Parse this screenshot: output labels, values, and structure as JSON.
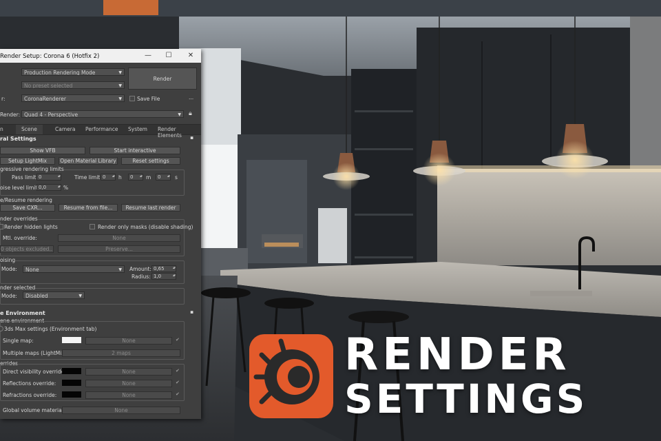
{
  "window": {
    "title": "Render Setup: Corona 6 (Hotfix 2)",
    "minimize": "—",
    "maximize": "☐",
    "close": "✕"
  },
  "setup": {
    "mode_value": "Production Rendering Mode",
    "preset_value": "No preset selected",
    "renderer_label": "r:",
    "renderer_value": "CoronaRenderer",
    "view_label": "Render:",
    "view_value": "Quad 4 - Perspective",
    "render_button": "Render",
    "save_file_label": "Save File",
    "more_label": "..."
  },
  "tabs": [
    {
      "label": "n"
    },
    {
      "label": "Scene"
    },
    {
      "label": "Camera"
    },
    {
      "label": "Performance"
    },
    {
      "label": "System"
    },
    {
      "label": "Render Elements"
    }
  ],
  "general": {
    "header": "ral Settings",
    "show_vfb": "Show VFB",
    "start_interactive": "Start interactive",
    "setup_lightmix": "Setup LightMix",
    "open_material_library": "Open Material Library",
    "reset_settings": "Reset settings"
  },
  "progressive": {
    "header": "gressive rendering limits",
    "pass_limit_label": "Pass limit:",
    "pass_limit_value": "0",
    "time_limit_label": "Time limit:",
    "time_h": "0",
    "time_m": "0",
    "time_s": "0",
    "h": "h",
    "m": "m",
    "s": "s",
    "noise_label": "oise level limit:",
    "noise_value": "0,0",
    "pct": "%"
  },
  "save_resume": {
    "header": "e/Resume rendering",
    "save_cxr": "Save CXR...",
    "resume_from_file": "Resume from file...",
    "resume_last": "Resume last render"
  },
  "overrides": {
    "header": "nder overrides",
    "render_hidden_lights": "Render hidden lights",
    "render_only_masks": "Render only masks (disable shading)",
    "mtl_override_label": "Mtl. override:",
    "mtl_override_value": "None",
    "objects_excluded": "0 objects excluded...",
    "preserve": "Preserve..."
  },
  "denoising": {
    "header": "oising",
    "mode_label": "Mode:",
    "mode_value": "None",
    "amount_label": "Amount:",
    "amount_value": "0,65",
    "radius_label": "Radius:",
    "radius_value": "1,0"
  },
  "render_selected": {
    "header": "nder selected",
    "mode_label": "Mode:",
    "mode_value": "Disabled"
  },
  "environment": {
    "section": "e Environment",
    "sub_header": "ene environment",
    "max_settings": "3ds Max settings (Environment tab)",
    "single_map_label": "Single map:",
    "single_map_value": "None",
    "multiple_maps_label": "Multiple maps (LightMix):",
    "multiple_maps_value": "2 maps",
    "overrides_header": "errides",
    "direct_label": "Direct visibility override:",
    "direct_value": "None",
    "reflections_label": "Reflections override:",
    "reflections_value": "None",
    "refractions_label": "Refractions override:",
    "refractions_value": "None",
    "global_volume_label": "Global volume material:",
    "global_volume_value": "None"
  },
  "overlay": {
    "line1": "RENDER",
    "line2": "SETTINGS",
    "logo_color": "#e35a2b"
  },
  "colors": {
    "panel_bg": "#3f3f3f",
    "accent_orange": "#e35a2b"
  }
}
